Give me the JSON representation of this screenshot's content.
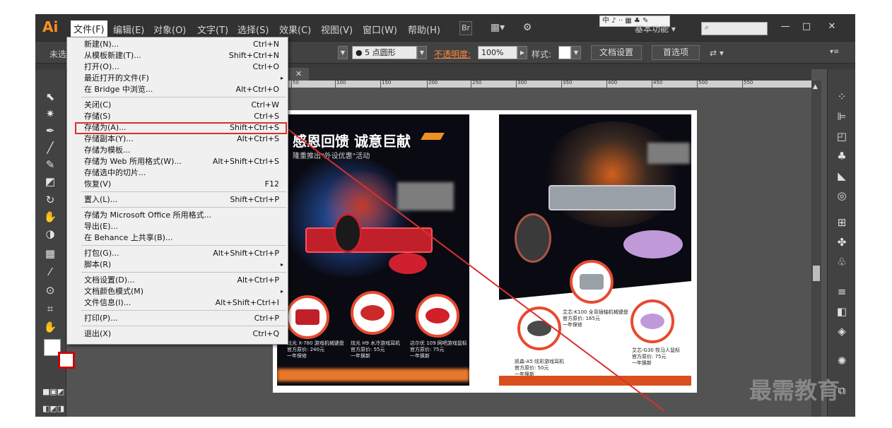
{
  "app": {
    "logo": "Ai",
    "menus": [
      "文件(F)",
      "编辑(E)",
      "对象(O)",
      "文字(T)",
      "选择(S)",
      "效果(C)",
      "视图(V)",
      "窗口(W)",
      "帮助(H)"
    ],
    "bridge_button": "Br",
    "workspace": "基本功能",
    "ime_bar": "中 ♪ ·· ▦ ♣ ✎",
    "window_controls": {
      "minimize": "—",
      "restore": "□",
      "close": "✕"
    }
  },
  "controlbar": {
    "selection_status": "未选",
    "brush": "● 5 点圆形",
    "opacity_label": "不透明度:",
    "opacity_value": "100%",
    "style_label": "样式:",
    "doc_setup_button": "文档设置",
    "prefs_button": "首选项"
  },
  "ruler": {
    "ticks": [
      "50",
      "100",
      "150",
      "200",
      "250",
      "300",
      "350",
      "400",
      "450",
      "500",
      "550"
    ]
  },
  "file_menu": {
    "items": [
      {
        "label": "新建(N)...",
        "shortcut": "Ctrl+N"
      },
      {
        "label": "从模板新建(T)...",
        "shortcut": "Shift+Ctrl+N"
      },
      {
        "label": "打开(O)...",
        "shortcut": "Ctrl+O"
      },
      {
        "label": "最近打开的文件(F)",
        "shortcut": "▸"
      },
      {
        "label": "在 Bridge 中浏览...",
        "shortcut": "Alt+Ctrl+O"
      },
      {
        "label": "关闭(C)",
        "shortcut": "Ctrl+W"
      },
      {
        "label": "存储(S)",
        "shortcut": "Ctrl+S"
      },
      {
        "label": "存储为(A)...",
        "shortcut": "Shift+Ctrl+S"
      },
      {
        "label": "存储副本(Y)...",
        "shortcut": "Alt+Ctrl+S"
      },
      {
        "label": "存储为模板...",
        "shortcut": ""
      },
      {
        "label": "存储为 Web 所用格式(W)...",
        "shortcut": "Alt+Shift+Ctrl+S"
      },
      {
        "label": "存储选中的切片...",
        "shortcut": ""
      },
      {
        "label": "恢复(V)",
        "shortcut": "F12"
      },
      {
        "label": "置入(L)...",
        "shortcut": "Shift+Ctrl+P"
      },
      {
        "label": "存储为 Microsoft Office 所用格式...",
        "shortcut": ""
      },
      {
        "label": "导出(E)...",
        "shortcut": ""
      },
      {
        "label": "在 Behance 上共享(B)...",
        "shortcut": ""
      },
      {
        "label": "打包(G)...",
        "shortcut": "Alt+Shift+Ctrl+P"
      },
      {
        "label": "脚本(R)",
        "shortcut": "▸"
      },
      {
        "label": "文档设置(D)...",
        "shortcut": "Alt+Ctrl+P"
      },
      {
        "label": "文档颜色模式(M)",
        "shortcut": "▸"
      },
      {
        "label": "文件信息(I)...",
        "shortcut": "Alt+Shift+Ctrl+I"
      },
      {
        "label": "打印(P)...",
        "shortcut": "Ctrl+P"
      },
      {
        "label": "退出(X)",
        "shortcut": "Ctrl+Q"
      }
    ]
  },
  "artwork": {
    "headline": "感恩回馈 诚意巨献",
    "subline": "隆重推出\"外设优惠\"活动",
    "left_captions": [
      "炫光 X-780 游戏机械键盘\n官方原价: 240元\n一年保修",
      "炫光 H9 水冷游戏耳机\n官方原价: 55元\n一年换新",
      "达尔优 109 网吧游戏鼠标\n官方原价: 75元\n一年换新"
    ],
    "right_captions": [
      "艾芯-K100 全背插轴机械键盘\n官方原价: 165元\n一年保修",
      "凯森-A5 炫彩游戏耳机\n官方原价: 50元\n一年换新",
      "艾芯-G30 牧马人鼠标\n官方原价: 75元\n一年换新"
    ]
  },
  "watermark": "最需教育",
  "colors": {
    "accent": "#ff8f1f",
    "highlight": "#d9302c",
    "menu_bg": "#f0f0f0"
  }
}
